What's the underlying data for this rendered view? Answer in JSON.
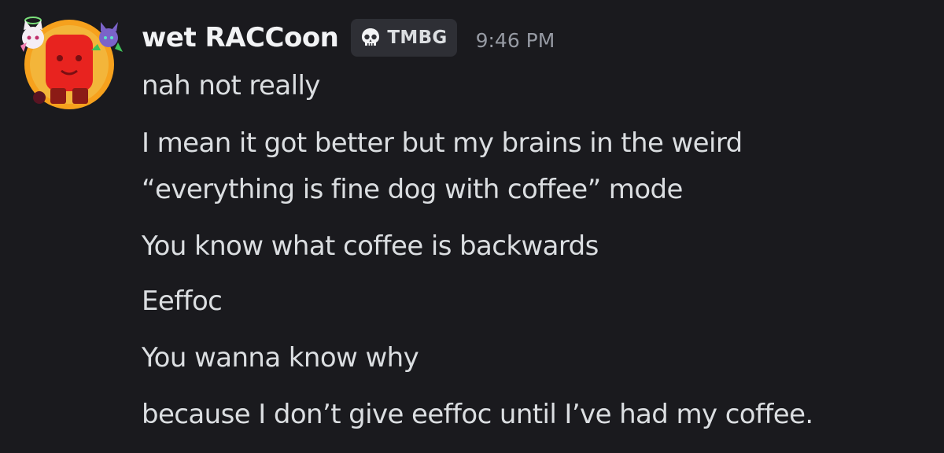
{
  "message": {
    "author": "wet RACCoon",
    "tag": {
      "icon": "skull-icon",
      "label": "TMBG"
    },
    "timestamp": "9:46 PM",
    "lines": [
      "nah not really",
      "I mean it got better but my brains in the weird",
      "“everything is fine dog with coffee” mode",
      "You know what coffee is backwards",
      "Eeffoc",
      "You wanna know why",
      "because I don’t give eeffoc until I’ve had my coffee."
    ]
  },
  "colors": {
    "background": "#1a1a1e",
    "username": "#f2f3f5",
    "text": "#dbdee1",
    "timestamp": "#969aa3",
    "tag_background": "#2e2f35",
    "avatar_ring": "#f6a11d",
    "avatar_character": "#e8231f"
  }
}
